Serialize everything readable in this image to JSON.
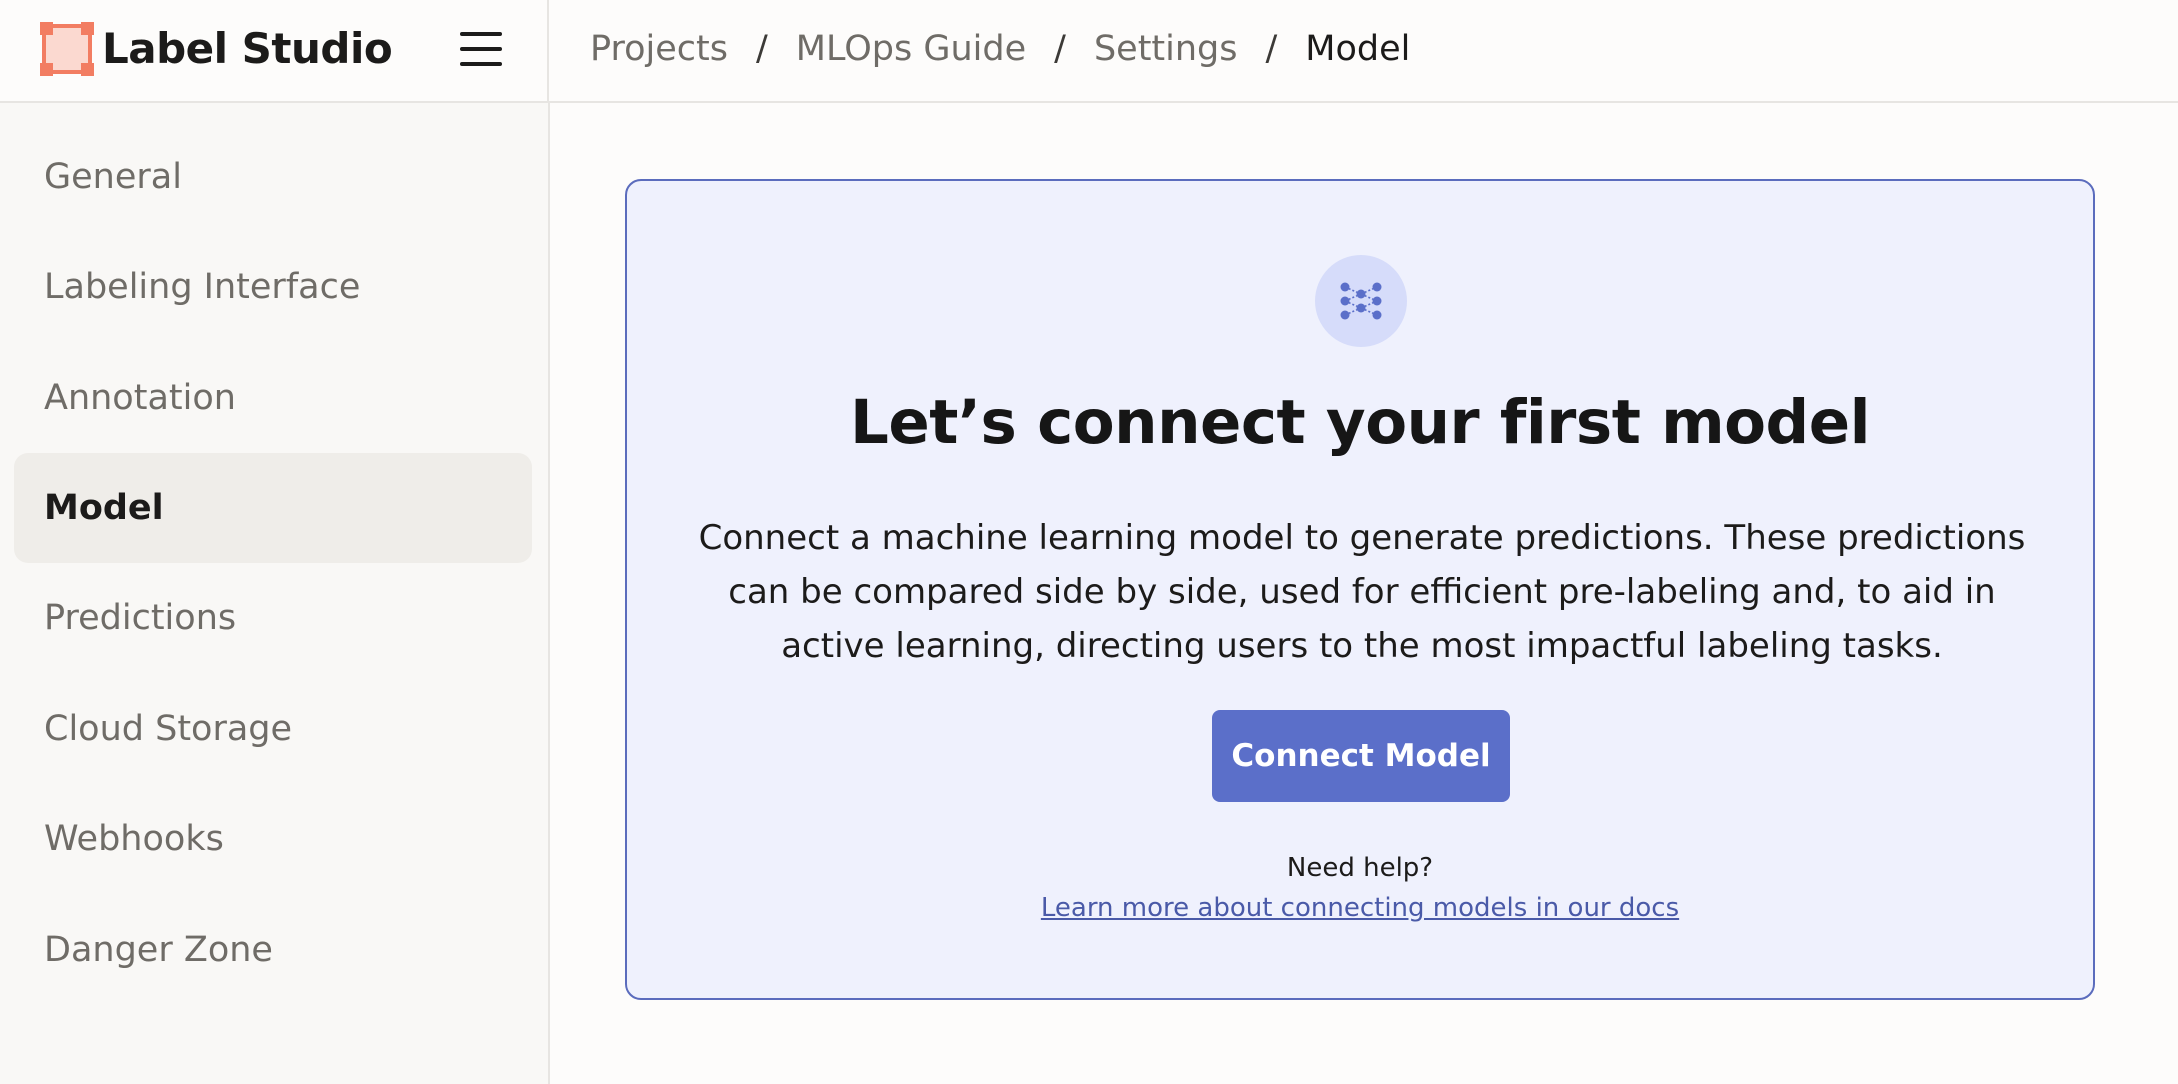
{
  "app": {
    "name": "Label Studio",
    "brand_color": "#f27d62"
  },
  "breadcrumb": {
    "items": [
      "Projects",
      "MLOps Guide",
      "Settings",
      "Model"
    ],
    "separator": "/"
  },
  "sidebar": {
    "items": [
      {
        "label": "General",
        "active": false
      },
      {
        "label": "Labeling Interface",
        "active": false
      },
      {
        "label": "Annotation",
        "active": false
      },
      {
        "label": "Model",
        "active": true
      },
      {
        "label": "Predictions",
        "active": false
      },
      {
        "label": "Cloud Storage",
        "active": false
      },
      {
        "label": "Webhooks",
        "active": false
      },
      {
        "label": "Danger Zone",
        "active": false
      }
    ]
  },
  "main": {
    "icon": "neural-network-icon",
    "title": "Let’s connect your first model",
    "description": "Connect a machine learning model to generate predictions. These predictions can be compared side by side, used for efficient pre-labeling and, to aid in active learning, directing users to the most impactful labeling tasks.",
    "connect_button_label": "Connect Model",
    "help_text": "Need help?",
    "help_link_label": "Learn more about connecting models in our docs"
  },
  "colors": {
    "accent": "#5b6fc9",
    "card_background": "#eff1fd",
    "card_border": "#5b6cbd"
  }
}
